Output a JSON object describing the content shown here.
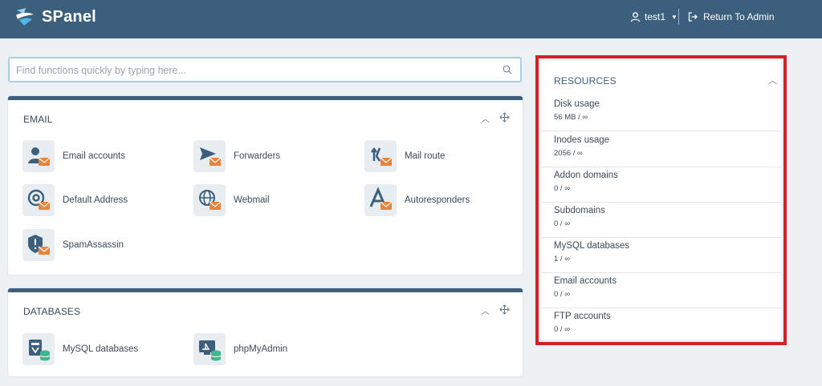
{
  "header": {
    "brand": "SPanel",
    "user": "test1",
    "return_label": "Return To Admin"
  },
  "search": {
    "placeholder": "Find functions quickly by typing here..."
  },
  "email_panel": {
    "title": "EMAIL",
    "items": [
      {
        "label": "Email accounts",
        "icon": "email-accounts-icon"
      },
      {
        "label": "Forwarders",
        "icon": "forwarders-icon"
      },
      {
        "label": "Mail route",
        "icon": "mail-route-icon"
      },
      {
        "label": "Default Address",
        "icon": "default-address-icon"
      },
      {
        "label": "Webmail",
        "icon": "webmail-icon"
      },
      {
        "label": "Autoresponders",
        "icon": "autoresponders-icon"
      },
      {
        "label": "SpamAssassin",
        "icon": "spamassassin-icon"
      }
    ]
  },
  "databases_panel": {
    "title": "DATABASES",
    "items": [
      {
        "label": "MySQL databases",
        "icon": "mysql-databases-icon"
      },
      {
        "label": "phpMyAdmin",
        "icon": "phpmyadmin-icon"
      }
    ]
  },
  "resources": {
    "title": "RESOURCES",
    "items": [
      {
        "label": "Disk usage",
        "value": "56 MB / ∞"
      },
      {
        "label": "Inodes usage",
        "value": "2056 / ∞"
      },
      {
        "label": "Addon domains",
        "value": "0 / ∞"
      },
      {
        "label": "Subdomains",
        "value": "0 / ∞"
      },
      {
        "label": "MySQL databases",
        "value": "1 / ∞"
      },
      {
        "label": "Email accounts",
        "value": "0 / ∞"
      },
      {
        "label": "FTP accounts",
        "value": "0 / ∞"
      }
    ]
  },
  "colors": {
    "header_bg": "#3b5f7c",
    "accent_orange": "#e8833a",
    "db_green": "#3fb68b",
    "highlight_red": "#d0202a"
  }
}
